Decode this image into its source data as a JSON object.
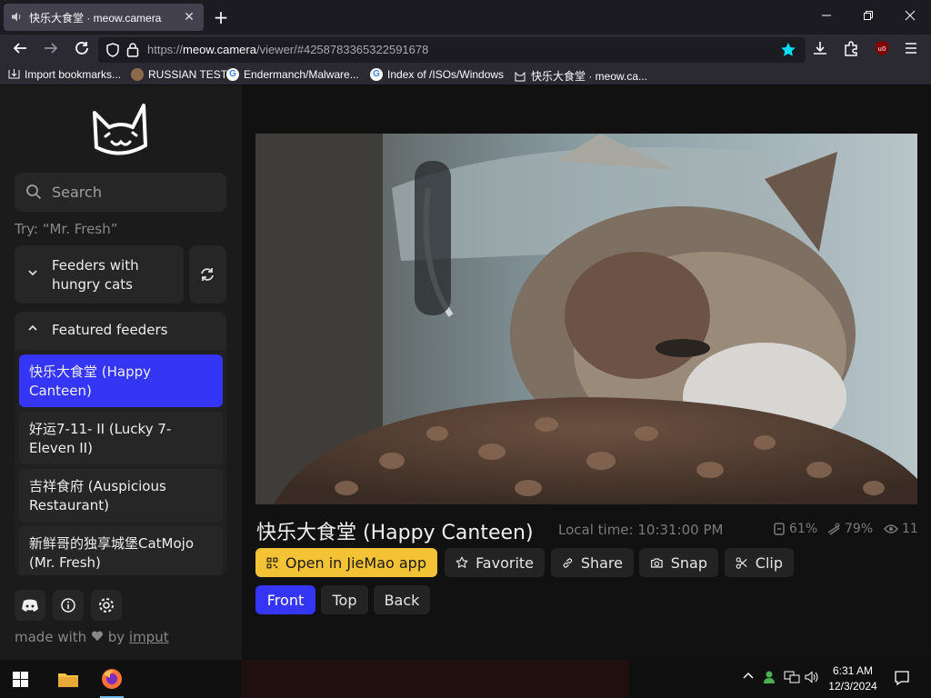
{
  "browser": {
    "tab_title": "快乐大食堂 · meow.camera",
    "tab_close": "✕",
    "new_tab": "+",
    "url_prefix": "https://",
    "url_domain": "meow.camera",
    "url_path": "/viewer/#4258783365322591678",
    "bookmarks": [
      "Import bookmarks...",
      "RUSSIAN TEST",
      "Endermanch/Malware...",
      "Index of /ISOs/Windows",
      "快乐大食堂 · meow.ca..."
    ]
  },
  "sidebar": {
    "search_placeholder": "Search",
    "try_hint": "Try: “Mr. Fresh”",
    "hungry_label": "Feeders with hungry cats",
    "featured_label": "Featured feeders",
    "featured_items": [
      "快乐大食堂 (Happy Canteen)",
      "好运7-11- II (Lucky 7-Eleven II)",
      "吉祥食府 (Auspicious Restaurant)",
      "新鲜哥的独享城堡CatMojo (Mr. Fresh)"
    ],
    "made_with": "made with",
    "by": "by",
    "author": "imput"
  },
  "viewer": {
    "feeder_title": "快乐大食堂 (Happy Canteen)",
    "local_time": "Local time: 10:31:00 PM",
    "food_level": "61%",
    "battery_level": "79%",
    "viewers": "11",
    "buttons": {
      "open_app": "Open in JieMao app",
      "favorite": "Favorite",
      "share": "Share",
      "snap": "Snap",
      "clip": "Clip"
    },
    "cameras": [
      "Front",
      "Top",
      "Back"
    ],
    "active_camera": "Front"
  },
  "taskbar": {
    "time": "6:31 AM",
    "date": "12/3/2024"
  },
  "colors": {
    "accent": "#3535f5",
    "yellow": "#f4c235"
  }
}
